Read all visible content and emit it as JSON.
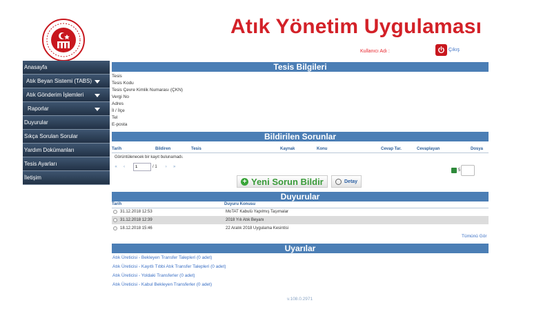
{
  "app": {
    "title": "Atık Yönetim Uygulaması"
  },
  "user": {
    "label": "Kullanıcı Adı :",
    "logout_label": "Çıkış"
  },
  "sidebar": {
    "items": [
      {
        "label": "Anasayfa",
        "has_caret": false
      },
      {
        "label": "Atık Beyan Sistemi (TABS)",
        "has_caret": true
      },
      {
        "label": "Atık Gönderim İşlemleri",
        "has_caret": true
      },
      {
        "label": "Raporlar",
        "has_caret": true
      },
      {
        "label": "Duyurular",
        "has_caret": false
      },
      {
        "label": "Sıkça Sorulan Sorular",
        "has_caret": false
      },
      {
        "label": "Yardım Dokümanları",
        "has_caret": false
      },
      {
        "label": "Tesis Ayarları",
        "has_caret": false
      },
      {
        "label": "İletişim",
        "has_caret": false
      }
    ]
  },
  "facility": {
    "title": "Tesis Bilgileri",
    "fields": [
      "Tesis",
      "Tesis Kodu",
      "Tesis Çevre Kimlik Numarası (ÇKN)",
      "Vergi No",
      "Adres",
      "İl / İlçe",
      "Tel",
      "E-posta"
    ]
  },
  "issues": {
    "title": "Bildirilen Sorunlar",
    "columns": [
      "Tarih",
      "Bildiren",
      "Tesis",
      "Kaynak",
      "Konu",
      "Cevap Tar.",
      "Cevaplayan",
      "Dosya"
    ],
    "empty_message": "Görüntülenecek bir kayıt bulunamadı.",
    "page": "1",
    "page_total": "/ 1",
    "export_count": "5",
    "new_button": "Yeni Sorun Bildir",
    "detail_button": "Detay"
  },
  "announcements": {
    "title": "Duyurular",
    "columns": [
      "Tarih",
      "Duyuru Konusu"
    ],
    "rows": [
      {
        "date": "31.12.2018 12:53",
        "subject": "MoTAT Kabulü Yapılmış Taşımalar"
      },
      {
        "date": "31.12.2018 12:39",
        "subject": "2018 Yılı Atık Beyanı"
      },
      {
        "date": "18.12.2018 15:46",
        "subject": "22 Aralık 2018 Uygulama Kesintisi"
      }
    ],
    "all_link": "Tümünü Gör"
  },
  "warnings": {
    "title": "Uyarılar",
    "links": [
      "Atık Üreticisi - Bekleyen Transfer Talepleri (0 adet)",
      "Atık Üreticisi - Kayıtlı Tıbbi Atık Transfer Talepleri (0 adet)",
      "Atık Üreticisi - Yoldaki Transferler (0 adet)",
      "Atık Üreticisi - Kabul Bekleyen Transferler (0 adet)"
    ]
  },
  "footer": {
    "version": "v.108.0.2971"
  },
  "colors": {
    "accent": "#4b7eb5",
    "title_red": "#d32128",
    "link_blue": "#3a6fc4",
    "sidebar_bg": "#2f425a",
    "button_green": "#3a9b3a"
  }
}
